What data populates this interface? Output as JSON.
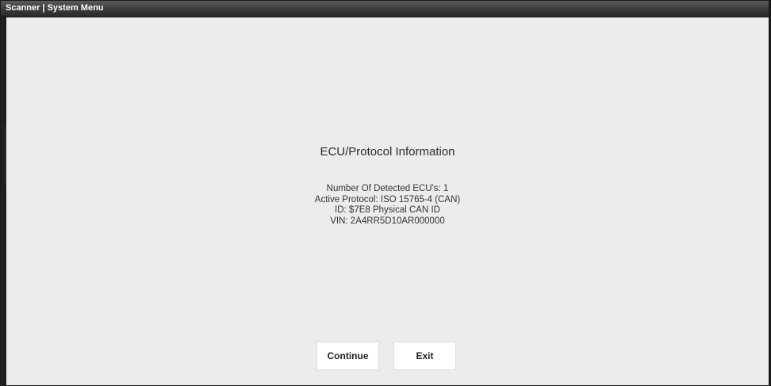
{
  "window": {
    "title": "Scanner | System Menu"
  },
  "main": {
    "heading": "ECU/Protocol Information",
    "info_lines": [
      "Number Of Detected ECU's: 1",
      "Active Protocol: ISO 15765-4 (CAN)",
      "ID: $7E8 Physical CAN ID",
      "VIN: 2A4RR5D10AR000000"
    ]
  },
  "buttons": {
    "continue_label": "Continue",
    "exit_label": "Exit"
  },
  "colors": {
    "titlebar": "#3a3a3a",
    "background": "#ececec",
    "button_bg": "#ffffff",
    "text": "#2b2b2b"
  }
}
